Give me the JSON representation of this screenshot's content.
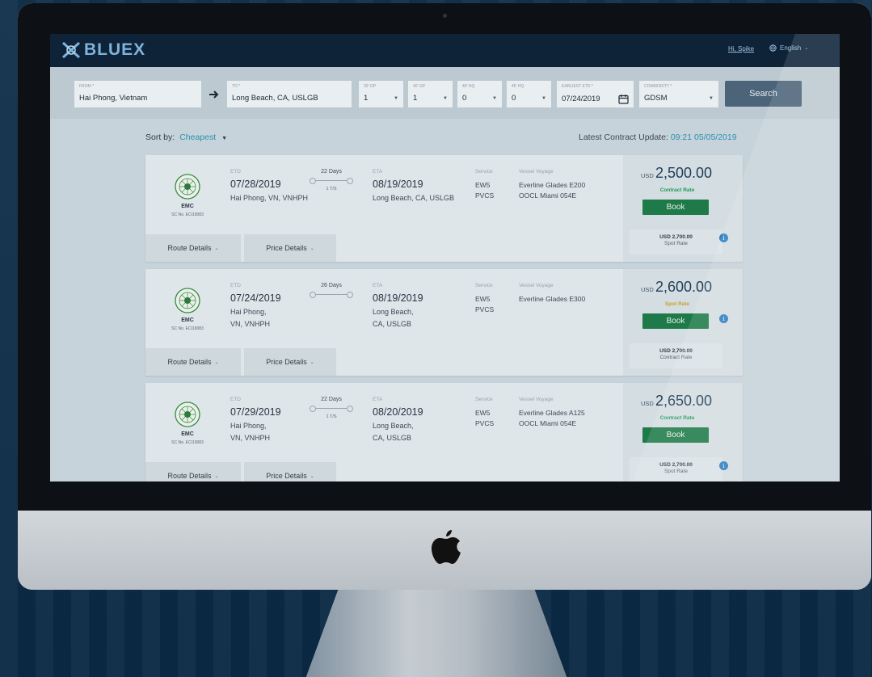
{
  "brand": {
    "logo_text": "BLUEX"
  },
  "header": {
    "user_link": "Hi, Spike",
    "language": "English"
  },
  "search": {
    "from": {
      "label": "FROM *",
      "value": "Hai Phong, Vietnam"
    },
    "to": {
      "label": "TO *",
      "value": "Long Beach, CA, USLGB"
    },
    "gp20": {
      "label": "20' GP",
      "value": "1"
    },
    "gp40": {
      "label": "40' GP",
      "value": "1"
    },
    "hq40": {
      "label": "40' HQ",
      "value": "0"
    },
    "hq45": {
      "label": "45' HQ",
      "value": "0"
    },
    "etd": {
      "label": "EARLIEST ETD *",
      "value": "07/24/2019"
    },
    "commodity": {
      "label": "COMMODITY *",
      "value": "GDSM"
    },
    "button": "Search"
  },
  "sort": {
    "label": "Sort by:",
    "value": "Cheapest"
  },
  "update": {
    "label": "Latest Contract Update:",
    "time": "09:21 05/05/2019"
  },
  "labels": {
    "etd": "ETD",
    "eta": "ETA",
    "service": "Service",
    "vessel": "Vessel Voyage",
    "usd": "USD",
    "route_details": "Route Details",
    "price_details": "Price Details",
    "book": "Book"
  },
  "colors": {
    "contract_rate": "#1e9a5a",
    "spot_rate": "#c9a227",
    "accent": "#2a8fb0"
  },
  "results": [
    {
      "carrier": "EMC",
      "sc_no": "SC No. ECI19083",
      "etd_date": "07/28/2019",
      "etd_place_1": "Hai Phong, VN, VNHPH",
      "etd_place_2": "",
      "days": "22 Days",
      "ts": "1 T/S",
      "eta_date": "08/19/2019",
      "eta_place_1": "Long Beach, CA, USLGB",
      "eta_place_2": "",
      "service_1": "EW5",
      "service_2": "PVCS",
      "vessel_1": "Everline Glades  E200",
      "vessel_2": "OOCL Miami  054E",
      "price": "2,500.00",
      "rate_type": "Contract Rate",
      "alt_price": "USD 2,700.00",
      "alt_type": "Spot Rate"
    },
    {
      "carrier": "EMC",
      "sc_no": "SC No. ECI19083",
      "etd_date": "07/24/2019",
      "etd_place_1": "Hai Phong,",
      "etd_place_2": "VN, VNHPH",
      "days": "26 Days",
      "ts": "",
      "eta_date": "08/19/2019",
      "eta_place_1": "Long Beach,",
      "eta_place_2": "CA, USLGB",
      "service_1": "EW5",
      "service_2": "PVCS",
      "vessel_1": "Everline Glades  E300",
      "vessel_2": "",
      "price": "2,600.00",
      "rate_type": "Spot Rate",
      "alt_price": "USD 2,700.00",
      "alt_type": "Contract Rate"
    },
    {
      "carrier": "EMC",
      "sc_no": "SC No. ECI19083",
      "etd_date": "07/29/2019",
      "etd_place_1": "Hai Phong,",
      "etd_place_2": "VN, VNHPH",
      "days": "22 Days",
      "ts": "1 T/S",
      "eta_date": "08/20/2019",
      "eta_place_1": "Long Beach,",
      "eta_place_2": "CA, USLGB",
      "service_1": "EW5",
      "service_2": "PVCS",
      "vessel_1": "Everline Glades  A125",
      "vessel_2": "OOCL Miami  054E",
      "price": "2,650.00",
      "rate_type": "Contract Rate",
      "alt_price": "USD 2,700.00",
      "alt_type": "Spot Rate"
    }
  ]
}
